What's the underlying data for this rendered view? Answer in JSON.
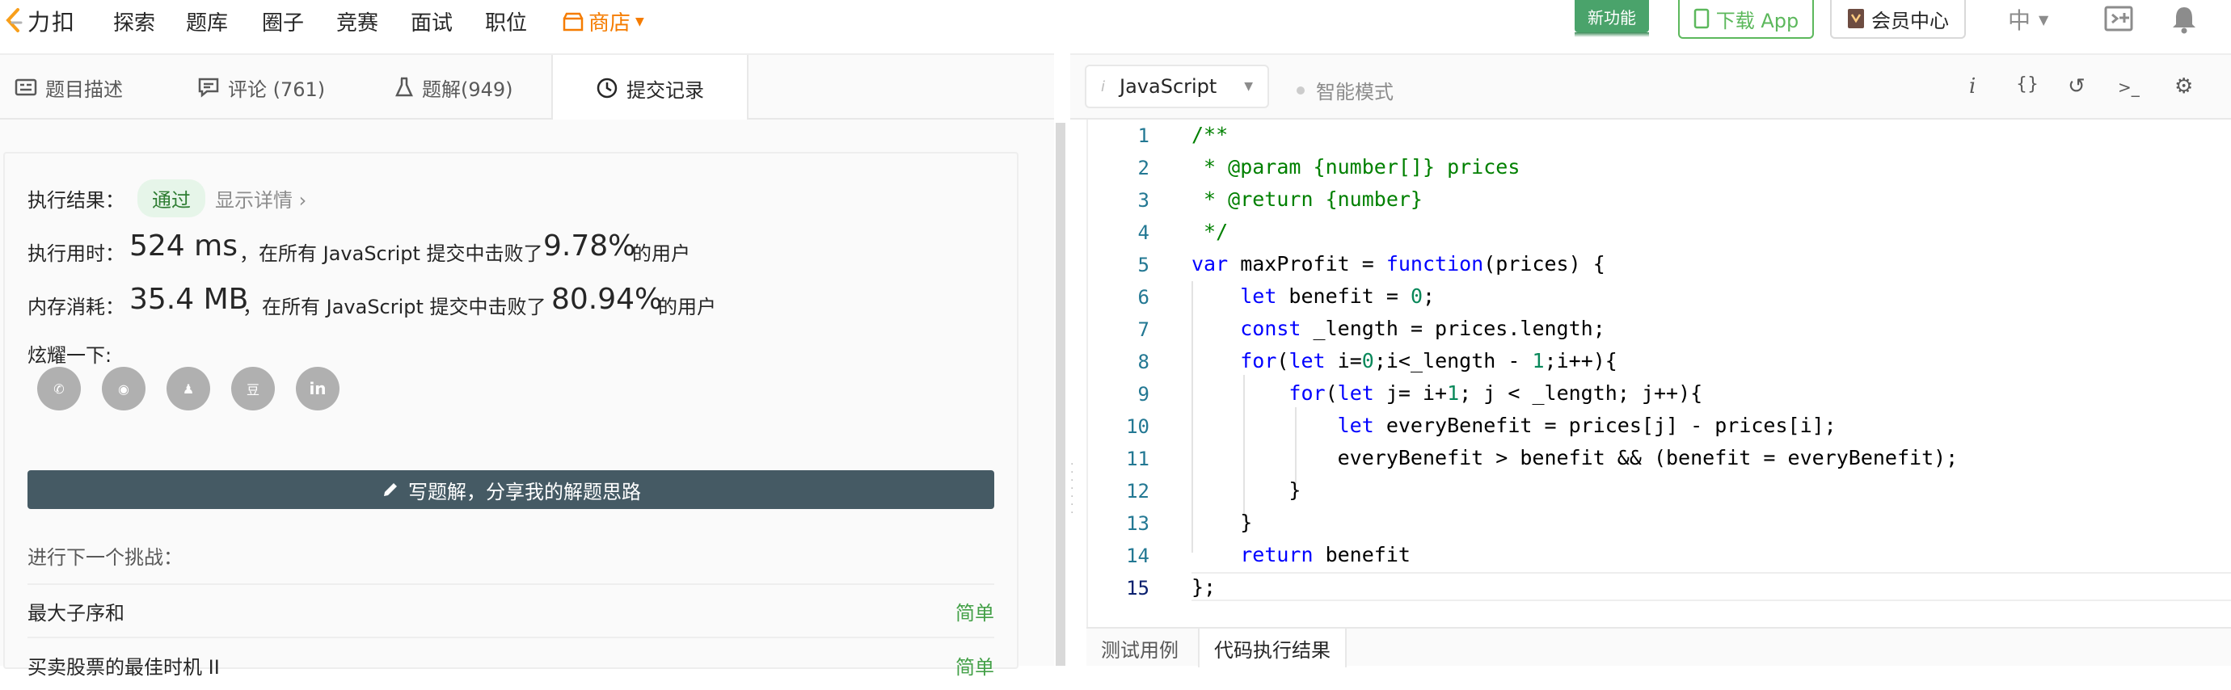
{
  "nav": {
    "logo_text": "力扣",
    "items": [
      "探索",
      "题库",
      "圈子",
      "竞赛",
      "面试",
      "职位"
    ],
    "shop": "商店",
    "new_feature": "新功能",
    "download": "下载 App",
    "vip": "会员中心",
    "language": "中"
  },
  "left_tabs": [
    {
      "label": "题目描述",
      "icon": "description-icon"
    },
    {
      "label": "评论 (761)",
      "icon": "comment-icon"
    },
    {
      "label": "题解(949)",
      "icon": "flask-icon"
    },
    {
      "label": "提交记录",
      "icon": "clock-icon"
    }
  ],
  "result": {
    "status_label": "执行结果：",
    "status": "通过",
    "detail_link": "显示详情 ›",
    "time_label": "执行用时：",
    "time_value": "524 ms",
    "time_mid": "，在所有 JavaScript 提交中击败了",
    "time_percent": "9.78%",
    "time_suffix": "的用户",
    "mem_label": "内存消耗：",
    "mem_value": "35.4 MB",
    "mem_mid": "，在所有 JavaScript 提交中击败了",
    "mem_percent": "80.94%",
    "mem_suffix": "的用户",
    "share_label": "炫耀一下:",
    "share_icons": [
      "wechat-icon",
      "weibo-icon",
      "qq-icon",
      "douban-icon",
      "linkedin-icon"
    ],
    "share_glyphs": [
      "✆",
      "◉",
      "♟",
      "豆",
      "in"
    ],
    "write_button": "写题解，分享我的解题思路",
    "next_label": "进行下一个挑战：",
    "next_challenges": [
      {
        "title": "最大子序和",
        "difficulty": "简单"
      },
      {
        "title": "买卖股票的最佳时机 II",
        "difficulty": "简单"
      }
    ]
  },
  "editor": {
    "language": "JavaScript",
    "smart_mode": "智能模式",
    "toolbar_icons": [
      "info-icon",
      "braces-icon",
      "reset-icon",
      "terminal-icon",
      "settings-icon"
    ],
    "toolbar_glyphs": [
      "i",
      "{}",
      "↺",
      ">_",
      "⚙"
    ],
    "line_numbers": [
      "1",
      "2",
      "3",
      "4",
      "5",
      "6",
      "7",
      "8",
      "9",
      "10",
      "11",
      "12",
      "13",
      "14",
      "15"
    ],
    "current_line": "15",
    "code_lines": [
      "/**",
      " * @param {number[]} prices",
      " * @return {number}",
      " */",
      "var maxProfit = function(prices) {",
      "    let benefit = 0;",
      "    const _length = prices.length;",
      "    for(let i=0;i<_length - 1;i++){",
      "        for(let j= i+1; j < _length; j++){",
      "            let everyBenefit = prices[j] - prices[i];",
      "            everyBenefit > benefit && (benefit = everyBenefit);",
      "        }",
      "    }",
      "    return benefit",
      "};"
    ]
  },
  "console_tabs": [
    "测试用例",
    "代码执行结果"
  ],
  "colors": {
    "accent": "#f57c00",
    "pass_green": "#43a047",
    "button_dark": "#455a64"
  }
}
